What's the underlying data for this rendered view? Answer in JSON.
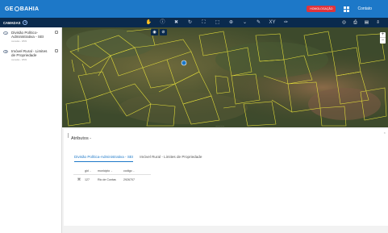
{
  "appbar": {
    "brand_left": "GE",
    "brand_right": "BAHIA",
    "badge": "Homologação",
    "contact": "Contato",
    "colors": {
      "bar": "#1d78c8",
      "badge": "#e0343c"
    }
  },
  "toolbar": {
    "layers_label": "CAMADAS",
    "add_icon": "+",
    "tools": [
      {
        "name": "hand-icon",
        "glyph": "✋"
      },
      {
        "name": "info-icon",
        "glyph": "ⓘ"
      },
      {
        "name": "tools-icon",
        "glyph": "✖"
      },
      {
        "name": "refresh-icon",
        "glyph": "↻"
      },
      {
        "name": "extent-icon",
        "glyph": "⛶"
      },
      {
        "name": "select-icon",
        "glyph": "⬚"
      },
      {
        "name": "zoom-icon",
        "glyph": "⊕"
      },
      {
        "name": "chevron-down-icon",
        "glyph": "⌄"
      },
      {
        "name": "measure-icon",
        "glyph": "✎"
      },
      {
        "name": "xy-icon",
        "glyph": "XY"
      },
      {
        "name": "draw-icon",
        "glyph": "✑"
      }
    ],
    "right_tools": [
      {
        "name": "layers-icon",
        "glyph": "◎"
      },
      {
        "name": "print-icon",
        "glyph": "⎙"
      },
      {
        "name": "document-icon",
        "glyph": "▤"
      },
      {
        "name": "download-icon",
        "glyph": "⇩"
      }
    ],
    "color": "#0a2a4d"
  },
  "sidebar": {
    "layers": [
      {
        "title": "Divisão Político-Administrativa - SEI",
        "subtitle": "camadas - WMS"
      },
      {
        "title": "Imóvel Rural - Limites de Propriedade",
        "subtitle": "camadas - WMS"
      }
    ]
  },
  "map": {
    "buttons": [
      "◉",
      "⊘"
    ],
    "zoom_in": "+",
    "zoom_out": "−",
    "attribution": "................"
  },
  "panel": {
    "title": "Atributos -",
    "close": "×",
    "tabs": [
      {
        "label": "Divisão Política-Administrativa - SEI",
        "active": true
      },
      {
        "label": "Imóvel Rural - Limites de Propriedade",
        "active": false
      }
    ],
    "columns": [
      "gid",
      "municipio",
      "codigo"
    ],
    "sort_glyph": "⌄",
    "rows": [
      {
        "icon": "⌘",
        "gid": "127",
        "municipio": "Rio de Contas",
        "codigo": "2926707"
      }
    ]
  }
}
